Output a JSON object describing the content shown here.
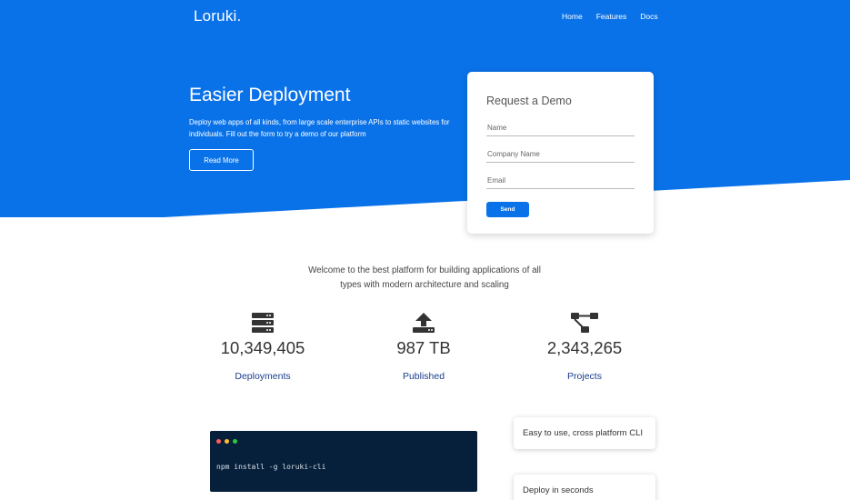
{
  "brand": {
    "name": "Loruki.",
    "accent": "#0a72e8"
  },
  "nav": {
    "items": [
      "Home",
      "Features",
      "Docs"
    ]
  },
  "hero": {
    "title": "Easier Deployment",
    "description": "Deploy web apps of all kinds, from large scale enterprise APIs to static websites for individuals. Fill out the form to try a demo of our platform",
    "button": "Read More"
  },
  "demo_form": {
    "title": "Request a Demo",
    "fields": {
      "name": "Name",
      "company": "Company Name",
      "email": "Email"
    },
    "submit": "Send"
  },
  "welcome": "Welcome to the best platform for building applications of all types with modern architecture and scaling",
  "stats": [
    {
      "icon": "server-icon",
      "value": "10,349,405",
      "label": "Deployments"
    },
    {
      "icon": "upload-icon",
      "value": "987 TB",
      "label": "Published"
    },
    {
      "icon": "project-diagram-icon",
      "value": "2,343,265",
      "label": "Projects"
    }
  ],
  "terminal": {
    "command": "npm install -g loruki-cli"
  },
  "features": [
    {
      "title": "Easy to use, cross platform CLI"
    },
    {
      "title": "Deploy in seconds"
    }
  ]
}
